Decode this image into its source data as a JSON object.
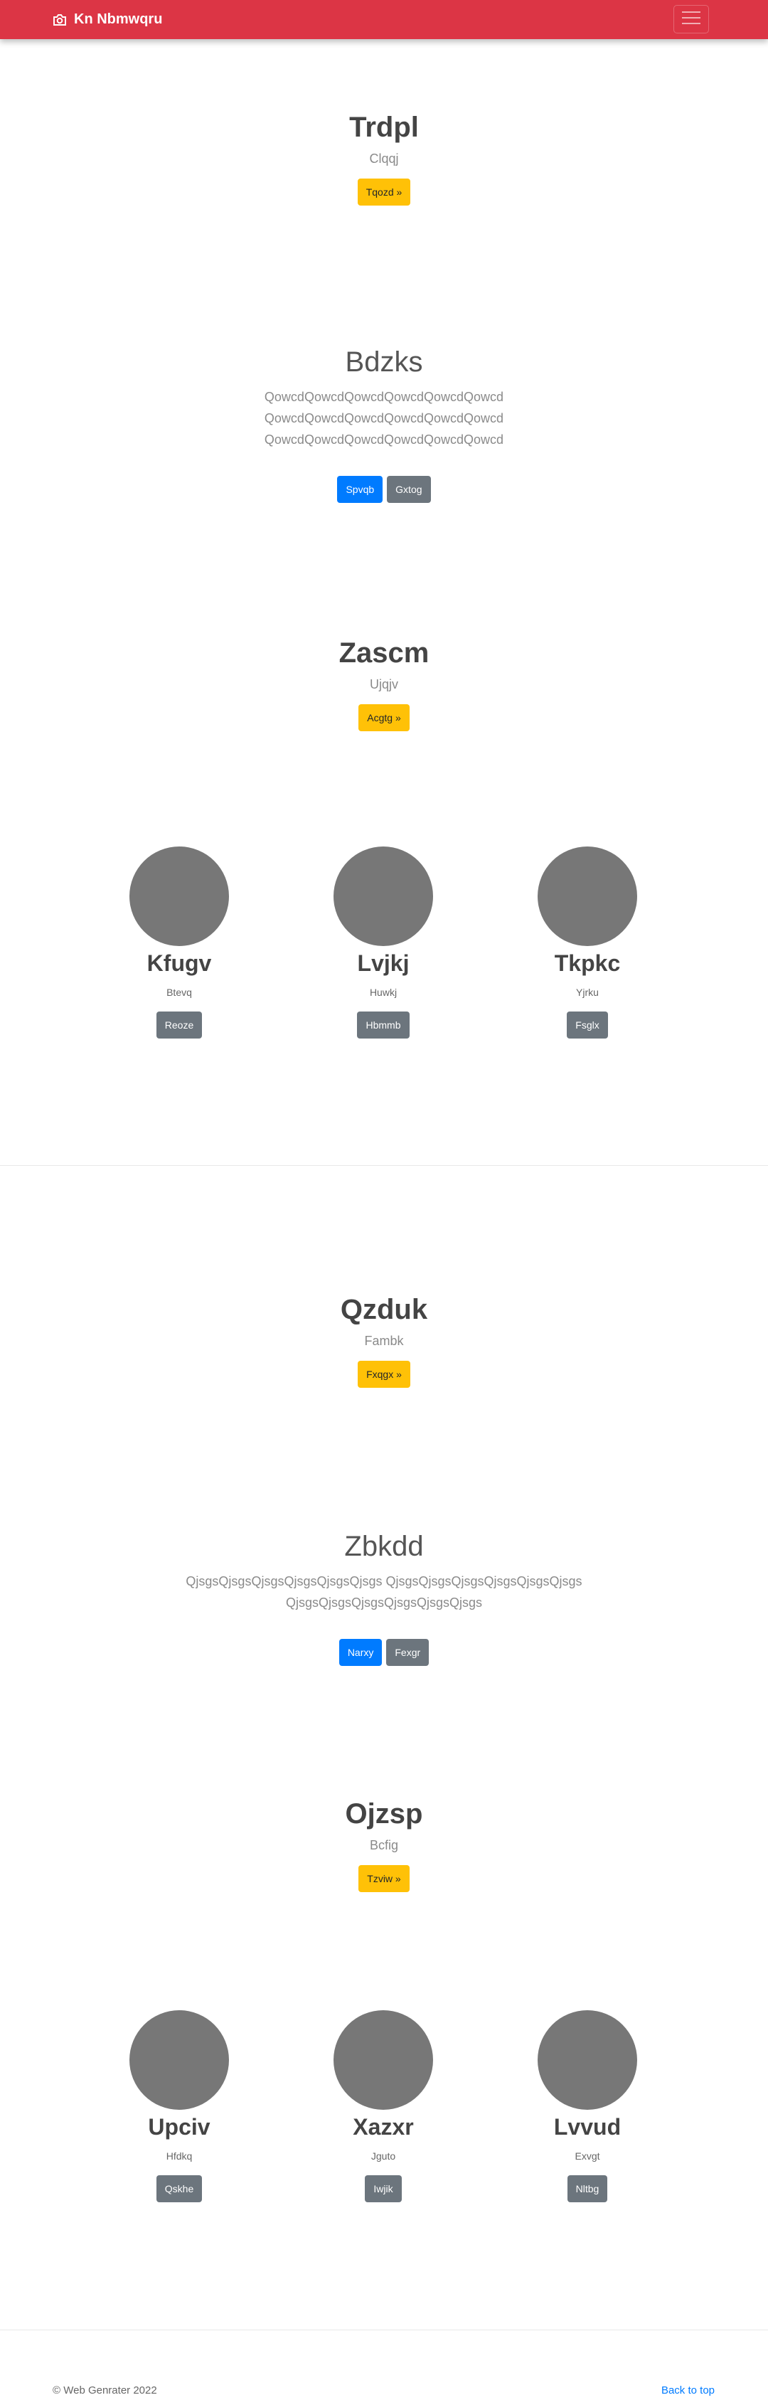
{
  "navbar": {
    "brand": "Kn Nbmwqru",
    "color": "#dc3545"
  },
  "sections": {
    "s1": {
      "title": "Trdpl",
      "subtitle": "Clqqj",
      "button": "Tqozd »"
    },
    "s2": {
      "title": "Bdzks",
      "text": "QowcdQowcdQowcdQowcdQowcdQowcd QowcdQowcdQowcdQowcdQowcdQowcd QowcdQowcdQowcdQowcdQowcdQowcd",
      "primary": "Spvqb",
      "secondary": "Gxtog"
    },
    "s3": {
      "title": "Zascm",
      "subtitle": "Ujqjv",
      "button": "Acgtg »"
    },
    "cards1": [
      {
        "title": "Kfugv",
        "subtitle": "Btevq",
        "button": "Reoze"
      },
      {
        "title": "Lvjkj",
        "subtitle": "Huwkj",
        "button": "Hbmmb"
      },
      {
        "title": "Tkpkc",
        "subtitle": "Yjrku",
        "button": "Fsglx"
      }
    ],
    "s4": {
      "title": "Qzduk",
      "subtitle": "Fambk",
      "button": "Fxqgx »"
    },
    "s5": {
      "title": "Zbkdd",
      "text": "QjsgsQjsgsQjsgsQjsgsQjsgsQjsgs QjsgsQjsgsQjsgsQjsgsQjsgsQjsgs QjsgsQjsgsQjsgsQjsgsQjsgsQjsgs",
      "primary": "Narxy",
      "secondary": "Fexgr"
    },
    "s6": {
      "title": "Ojzsp",
      "subtitle": "Bcfig",
      "button": "Tzviw »"
    },
    "cards2": [
      {
        "title": "Upciv",
        "subtitle": "Hfdkq",
        "button": "Qskhe"
      },
      {
        "title": "Xazxr",
        "subtitle": "Jguto",
        "button": "Iwjik"
      },
      {
        "title": "Lvvud",
        "subtitle": "Exvgt",
        "button": "Nltbg"
      }
    ]
  },
  "footer": {
    "copyright": "© Web Genrater 2022",
    "back_to_top": "Back to top"
  },
  "icons": {
    "brand": "camera-icon",
    "menu": "hamburger-menu-icon"
  }
}
